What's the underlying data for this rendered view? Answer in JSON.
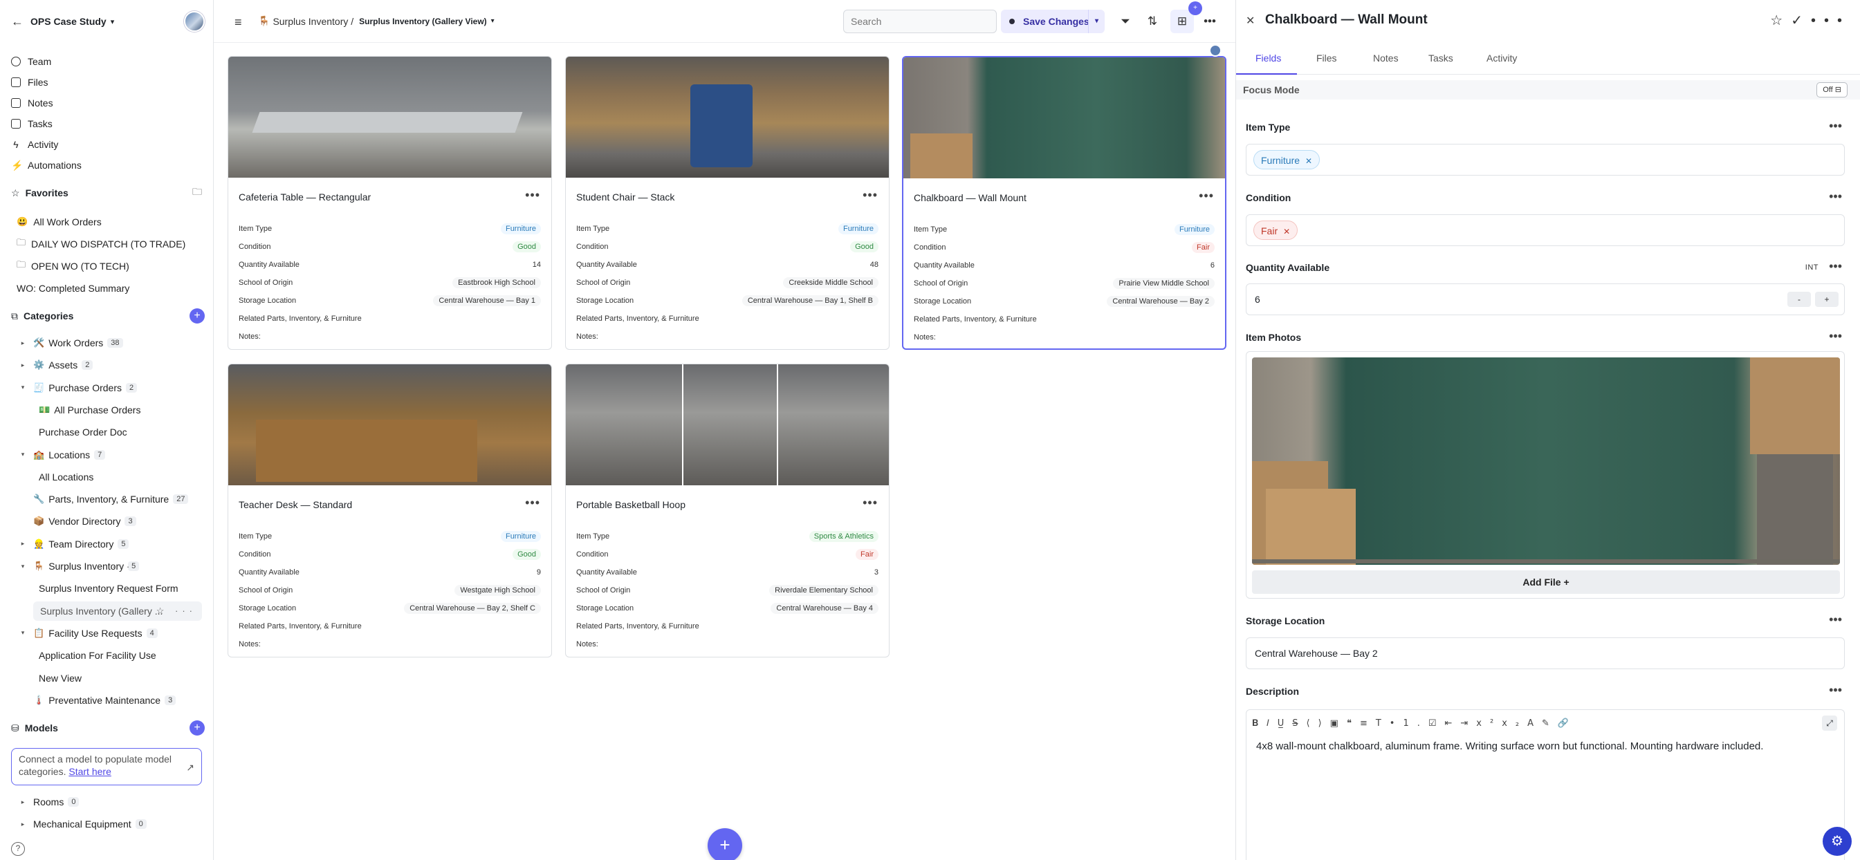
{
  "workspace": {
    "name": "OPS Case Study"
  },
  "sidebar": {
    "nav": [
      {
        "label": "Team"
      },
      {
        "label": "Files"
      },
      {
        "label": "Notes"
      },
      {
        "label": "Tasks"
      },
      {
        "label": "Activity"
      },
      {
        "label": "Automations"
      }
    ],
    "favorites_title": "Favorites",
    "favorites": [
      {
        "label": "All Work Orders",
        "icon": "😃"
      },
      {
        "label": "DAILY WO DISPATCH (TO TRADE)",
        "icon": "folder-icon"
      },
      {
        "label": "OPEN WO (TO TECH)",
        "icon": "folder-icon"
      },
      {
        "label": "WO: Completed Summary",
        "icon": ""
      }
    ],
    "categories_title": "Categories",
    "categories": [
      {
        "label": "Work Orders",
        "emoji": "🛠️",
        "count": "38",
        "toggle": "▸"
      },
      {
        "label": "Assets",
        "emoji": "⚙️",
        "count": "2",
        "toggle": "▸"
      },
      {
        "label": "Purchase Orders",
        "emoji": "🧾",
        "count": "2",
        "toggle": "▾"
      },
      {
        "label": "All Purchase Orders",
        "emoji": "💵",
        "count": "",
        "toggle": ""
      },
      {
        "label": "Purchase Order Doc",
        "emoji": "",
        "count": "",
        "toggle": ""
      },
      {
        "label": "Locations",
        "emoji": "🏫",
        "count": "7",
        "toggle": "▾"
      },
      {
        "label": "All Locations",
        "emoji": "",
        "count": "",
        "toggle": ""
      },
      {
        "label": "Parts, Inventory, & Furniture",
        "emoji": "🔧",
        "count": "27",
        "toggle": ""
      },
      {
        "label": "Vendor Directory",
        "emoji": "📦",
        "count": "3",
        "toggle": ""
      },
      {
        "label": "Team Directory",
        "emoji": "👷",
        "count": "5",
        "toggle": "▸"
      },
      {
        "label": "Surplus Inventory",
        "emoji": "🪑",
        "count": "5",
        "toggle": "▾"
      },
      {
        "label": "Surplus Inventory Request Form",
        "emoji": "",
        "count": "",
        "toggle": ""
      },
      {
        "label": "Surplus Inventory (Gallery ...",
        "emoji": "",
        "count": "",
        "toggle": ""
      },
      {
        "label": "Facility Use Requests",
        "emoji": "📋",
        "count": "4",
        "toggle": "▾"
      },
      {
        "label": "Application For Facility Use",
        "emoji": "",
        "count": "",
        "toggle": ""
      },
      {
        "label": "New View",
        "emoji": "",
        "count": "",
        "toggle": ""
      },
      {
        "label": "Preventative Maintenance",
        "emoji": "🌡️",
        "count": "3",
        "toggle": ""
      }
    ],
    "models_title": "Models",
    "connect_text": "Connect a model to populate model categories.",
    "connect_link": "Start here",
    "models": [
      {
        "label": "Rooms",
        "count": "0"
      },
      {
        "label": "Mechanical Equipment",
        "count": "0"
      }
    ],
    "help": "?"
  },
  "topbar": {
    "crumb_parent": "Surplus Inventory /",
    "crumb_parent_emoji": "🪑",
    "crumb_current": "Surplus Inventory (Gallery View)",
    "search_placeholder": "Search",
    "save_label": "Save Changes",
    "badge": "+"
  },
  "field_labels": {
    "item_type": "Item Type",
    "condition": "Condition",
    "qty": "Quantity Available",
    "school": "School of Origin",
    "storage": "Storage Location",
    "related": "Related Parts, Inventory, & Furniture",
    "notes": "Notes:"
  },
  "cards": [
    {
      "title": "Cafeteria Table — Rectangular",
      "item_type": "Furniture",
      "condition": "Good",
      "qty": "14",
      "school": "Eastbrook High School",
      "storage": "Central Warehouse — Bay 1"
    },
    {
      "title": "Student Chair — Stack",
      "item_type": "Furniture",
      "condition": "Good",
      "qty": "48",
      "school": "Creekside Middle School",
      "storage": "Central Warehouse — Bay 1, Shelf B"
    },
    {
      "title": "Chalkboard — Wall Mount",
      "item_type": "Furniture",
      "condition": "Fair",
      "qty": "6",
      "school": "Prairie View Middle School",
      "storage": "Central Warehouse — Bay 2"
    },
    {
      "title": "Teacher Desk — Standard",
      "item_type": "Furniture",
      "condition": "Good",
      "qty": "9",
      "school": "Westgate High School",
      "storage": "Central Warehouse — Bay 2, Shelf C"
    },
    {
      "title": "Portable Basketball Hoop",
      "item_type": "Sports & Athletics",
      "condition": "Fair",
      "qty": "3",
      "school": "Riverdale Elementary School",
      "storage": "Central Warehouse — Bay 4"
    }
  ],
  "detail": {
    "title": "Chalkboard — Wall Mount",
    "tabs": [
      "Fields",
      "Files",
      "Notes",
      "Tasks",
      "Activity"
    ],
    "focus_label": "Focus Mode",
    "focus_state": "Off",
    "item_type_label": "Item Type",
    "item_type_value": "Furniture",
    "condition_label": "Condition",
    "condition_value": "Fair",
    "qty_label": "Quantity Available",
    "qty_type": "INT",
    "qty_value": "6",
    "photos_label": "Item Photos",
    "add_file": "Add File",
    "storage_label": "Storage Location",
    "storage_value": "Central Warehouse — Bay 2",
    "description_label": "Description",
    "description_value": "4x8 wall-mount chalkboard, aluminum frame. Writing surface worn but functional. Mounting hardware included."
  },
  "colors": {
    "accent": "#6366f1",
    "good": "#2f8a43",
    "fair": "#c0392b",
    "furniture": "#2b7bb9"
  }
}
